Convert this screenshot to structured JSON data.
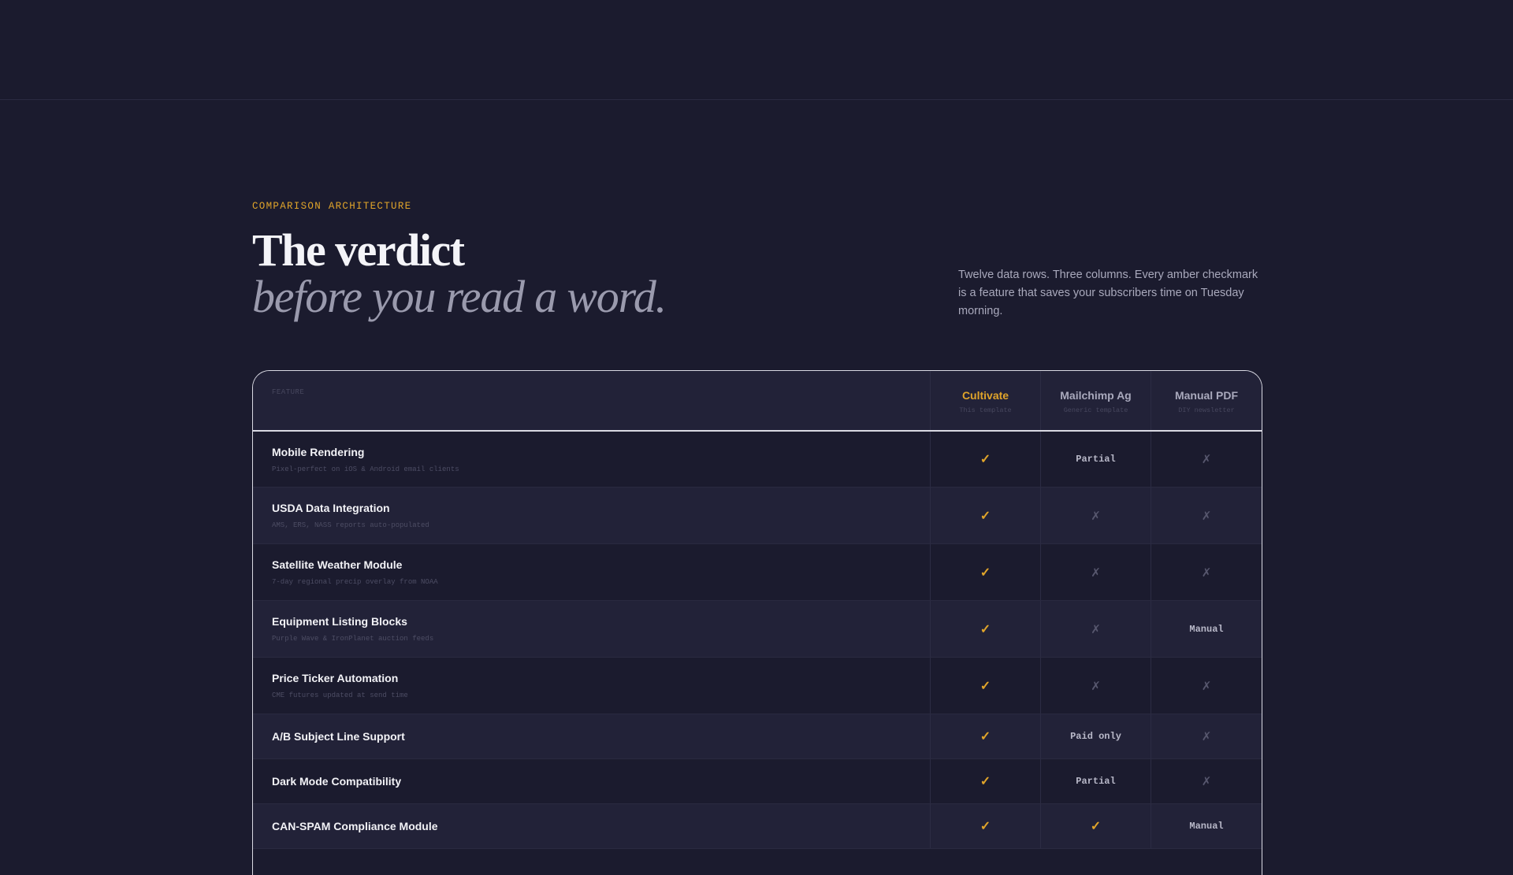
{
  "section": {
    "eyebrow": "COMPARISON ARCHITECTURE",
    "title_line1": "The verdict",
    "title_line2": "before you read a word.",
    "lede": "Twelve data rows. Three columns. Every amber checkmark is a feature that saves your subscribers time on Tuesday morning."
  },
  "table": {
    "feature_header": "FEATURE",
    "columns": [
      {
        "name": "Cultivate",
        "sub": "This template"
      },
      {
        "name": "Mailchimp Ag",
        "sub": "Generic template"
      },
      {
        "name": "Manual PDF",
        "sub": "DIY newsletter"
      }
    ],
    "rows": [
      {
        "name": "Mobile Rendering",
        "desc": "Pixel-perfect on iOS & Android email clients",
        "values": [
          "check",
          "Partial",
          "cross"
        ]
      },
      {
        "name": "USDA Data Integration",
        "desc": "AMS, ERS, NASS reports auto-populated",
        "values": [
          "check",
          "cross",
          "cross"
        ]
      },
      {
        "name": "Satellite Weather Module",
        "desc": "7-day regional precip overlay from NOAA",
        "values": [
          "check",
          "cross",
          "cross"
        ]
      },
      {
        "name": "Equipment Listing Blocks",
        "desc": "Purple Wave & IronPlanet auction feeds",
        "values": [
          "check",
          "cross",
          "Manual"
        ]
      },
      {
        "name": "Price Ticker Automation",
        "desc": "CME futures updated at send time",
        "values": [
          "check",
          "cross",
          "cross"
        ]
      },
      {
        "name": "A/B Subject Line Support",
        "desc": "",
        "values": [
          "check",
          "Paid only",
          "cross"
        ]
      },
      {
        "name": "Dark Mode Compatibility",
        "desc": "",
        "values": [
          "check",
          "Partial",
          "cross"
        ]
      },
      {
        "name": "CAN-SPAM Compliance Module",
        "desc": "",
        "values": [
          "check",
          "check",
          "Manual"
        ]
      }
    ]
  },
  "colors": {
    "accent": "#e0a42a",
    "background": "#1b1b2e",
    "row_alt": "#222238"
  },
  "icons": {
    "check": "checkmark-icon",
    "cross": "cross-icon"
  }
}
